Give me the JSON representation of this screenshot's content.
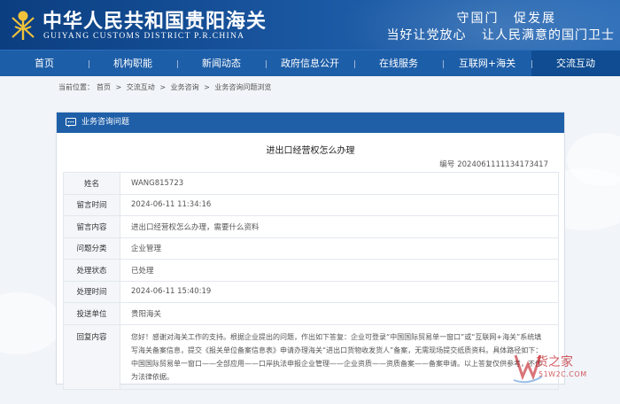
{
  "header": {
    "title": "中华人民共和国贵阳海关",
    "subtitle": "GUIYANG CUSTOMS DISTRICT P.R.CHINA",
    "slogan_line1": "守国门 促发展",
    "slogan_line2": "当好让党放心 让人民满意的国门卫士"
  },
  "nav": {
    "items": [
      "首页",
      "机构职能",
      "新闻动态",
      "政府信息公开",
      "在线服务",
      "互联网+海关",
      "交流互动"
    ],
    "active_index": 6
  },
  "breadcrumb": {
    "prefix": "当前位置：",
    "items": [
      "首页",
      ">",
      "交流互动",
      ">",
      "业务咨询",
      ">",
      "业务咨询问题浏览"
    ]
  },
  "panel": {
    "title": "业务咨询问题",
    "question_title": "进出口经营权怎么办理",
    "number_label": "编号",
    "number_value": "2024061111134173417",
    "rows": [
      {
        "key": "姓名",
        "value": "WANG815723"
      },
      {
        "key": "留言时间",
        "value": "2024-06-11 11:34:16"
      },
      {
        "key": "留言内容",
        "value": "进出口经营权怎么办理，需要什么资料"
      },
      {
        "key": "问题分类",
        "value": "企业管理"
      },
      {
        "key": "处理状态",
        "value": "已处理"
      },
      {
        "key": "处理时间",
        "value": "2024-06-11 15:40:19"
      },
      {
        "key": "投送单位",
        "value": "贵阳海关"
      }
    ],
    "reply_key": "回复内容",
    "reply_value": "您好！感谢对海关工作的支持。根据企业提出的问题，作出如下答复：企业可登录“中国国际贸易单一窗口”或“互联网+海关”系统填写海关备案信息，提交《报关单位备案信息表》申请办理海关“进出口货物收发货人”备案，无需现场提交纸质资料。具体路径如下：中国国际贸易单一窗口——全部应用——口岸执法申报企业管理——企业资质——资质备案——备案申请。以上答复仅供参考，不作为法律依据。"
  },
  "watermark": {
    "brand": "货之家",
    "url": "51W2C.COM"
  },
  "colors": {
    "header_blue": "#0b3e80",
    "nav_blue": "#1d5ea8",
    "panel_head": "#1f5fa8",
    "watermark_red": "#c0181f"
  }
}
